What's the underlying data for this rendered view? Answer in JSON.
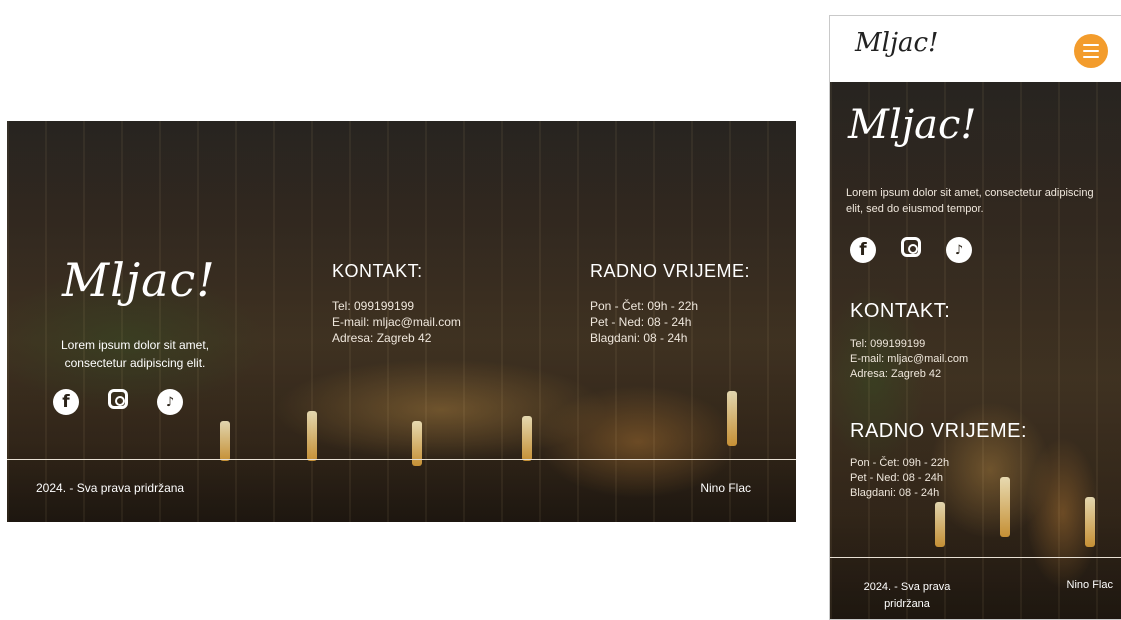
{
  "brand": {
    "logo_text": "Mljac!"
  },
  "about": {
    "desktop_text": "Lorem ipsum dolor sit amet, consectetur adipiscing elit.",
    "mobile_text": "Lorem ipsum dolor sit amet, consectetur adipiscing elit, sed do eiusmod tempor."
  },
  "social": [
    {
      "icon": "facebook-icon",
      "glyph": "f"
    },
    {
      "icon": "instagram-icon",
      "glyph": ""
    },
    {
      "icon": "tiktok-icon",
      "glyph": "♪"
    }
  ],
  "contact": {
    "title": "KONTAKT:",
    "lines": [
      "Tel: 099199199",
      "E-mail: mljac@mail.com",
      "Adresa: Zagreb 42"
    ]
  },
  "hours": {
    "title": "RADNO VRIJEME:",
    "lines": [
      "Pon - Čet: 09h - 22h",
      "Pet - Ned: 08 - 24h",
      "Blagdani: 08 - 24h"
    ]
  },
  "footer": {
    "copyright": "2024. - Sva prava pridržana",
    "author": "Nino Flac"
  },
  "colors": {
    "accent": "#f39c2c",
    "text": "#ffffff"
  }
}
